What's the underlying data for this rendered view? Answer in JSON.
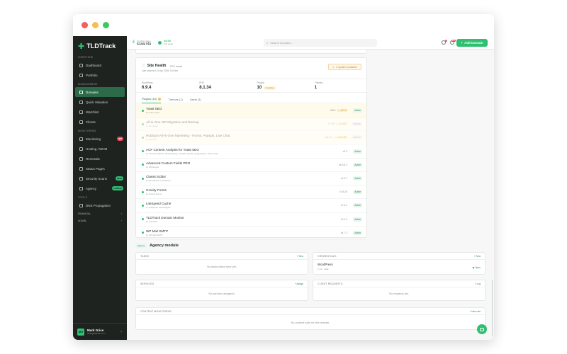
{
  "colors": {
    "accent": "#2fbf71",
    "sidebar": "#1e2320",
    "danger": "#e8455a",
    "warning": "#c98a1e"
  },
  "app": {
    "logo": "TLDTrack"
  },
  "sidebar": {
    "sections": {
      "overview": "OVERVIEW",
      "management": "MANAGEMENT",
      "monitoring": "MONITORING",
      "tools": "TOOLS"
    },
    "items": {
      "dashboard": "Dashboard",
      "portfolio": "Portfolio",
      "domains": "Domains",
      "quick_valuation": "Quick Valuation",
      "watchlist": "Watchlist",
      "clients": "Clients",
      "monitoring": "Monitoring",
      "monitoring_badge": "487",
      "hosting": "Hosting / WHM",
      "renewals": "Renewals",
      "status_pages": "Status Pages",
      "security_scans": "Security Scans",
      "security_badge": "NEW",
      "agency": "Agency",
      "agency_badge": "COMING",
      "dns": "DNS Propagation"
    },
    "groups": {
      "financial": "FINANCIAL",
      "admin": "ADMIN"
    },
    "user": {
      "initials": "MG",
      "name": "Mark Grice",
      "email": "hello@tldtrack.com"
    }
  },
  "topbar": {
    "portfolio_label": "Portfolio Value",
    "portfolio_value": "£144,741",
    "change_value": "€0.00",
    "change_label": "this week",
    "search_placeholder": "Search domains...",
    "notif_badge_1": "3",
    "notif_badge_2": "99+",
    "add_button": "Add Domain"
  },
  "site_health": {
    "title": "Site Health",
    "subtitle": "· 570 hosts",
    "last_scanned": "Last scanned 14 Apr 2026, 8:47am",
    "updates_badge": "3 updates available",
    "metrics": {
      "wp_label": "WordPress",
      "wp_value": "6.9.4",
      "php_label": "PHP",
      "php_value": "8.1.34",
      "plugins_label": "Plugins",
      "plugins_value": "10",
      "plugins_updates": "3 updates",
      "themes_label": "Themes",
      "themes_value": "1"
    },
    "tabs": {
      "plugins": "Plugins (10)",
      "themes": "Themes (1)",
      "users": "Users (1)"
    },
    "plugins": [
      {
        "name": "Yoast SEO",
        "by": "by Team Yoast",
        "ver": "v25.8",
        "new": "→ v27.4",
        "status": "Active"
      },
      {
        "name": "All-in-One WP Migration and Backup",
        "by": "by ServMask",
        "ver": "v7.95",
        "new": "→ v7.103",
        "status": "Inactive"
      },
      {
        "name": "HubSpot All-In-One Marketing - Forms, Popups, Live Chat",
        "by": "by HubSpot",
        "ver": "v11.3.6",
        "new": "→ v11.3.55",
        "status": "Inactive"
      },
      {
        "name": "ACF Content Analysis for Yoast SEO",
        "by": "by Thomas Kräftner, ViktorFroberg, marol87, pekz0r, angrycreative, Team Yoast",
        "ver": "v3.3",
        "new": "",
        "status": "Active"
      },
      {
        "name": "Advanced Custom Fields PRO",
        "by": "by WP Engine",
        "ver": "v6.3.6.1",
        "new": "",
        "status": "Active"
      },
      {
        "name": "Classic Editor",
        "by": "by WordPress Contributors",
        "ver": "v1.6.7",
        "new": "",
        "status": "Active"
      },
      {
        "name": "Gravity Forms",
        "by": "by Gravity Forms",
        "ver": "v2.9.20",
        "new": "",
        "status": "Active"
      },
      {
        "name": "LiteSpeed Cache",
        "by": "by LiteSpeed Technologies",
        "ver": "v7.6.2",
        "new": "",
        "status": "Active"
      },
      {
        "name": "TLDTrack Domain Monitor",
        "by": "by TLDTrack",
        "ver": "v2.2.0",
        "new": "",
        "status": "Active"
      },
      {
        "name": "WP Mail SMTP",
        "by": "by WP Mail SMTP",
        "ver": "v4.7.1",
        "new": "",
        "status": "Active"
      }
    ]
  },
  "agency": {
    "tag": "Agency",
    "title": "Agency module",
    "tasks": {
      "title": "TASKS",
      "action": "+ New",
      "empty": "No tasks linked here yet."
    },
    "credentials": {
      "title": "CREDENTIALS",
      "action": "+ New",
      "item_name": "WordPress",
      "item_sub": "1 csv · date",
      "item_action": "Open"
    },
    "services": {
      "title": "SERVICES",
      "action": "+ Assign",
      "empty": "No services assigned."
    },
    "requests": {
      "title": "CLIENT REQUESTS",
      "action": "+ Log",
      "empty": "No requests yet."
    },
    "content": {
      "title": "CONTENT MONITORING",
      "action": "+ New rule",
      "empty": "No content rules for this domain."
    }
  }
}
